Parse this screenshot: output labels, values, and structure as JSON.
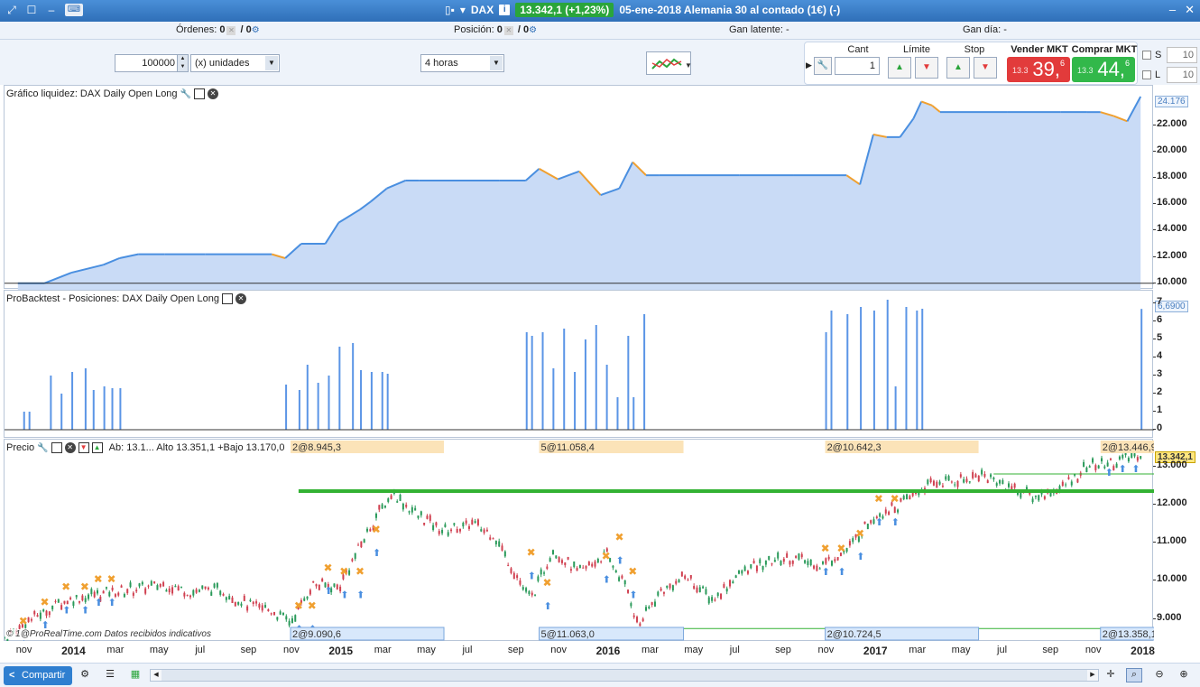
{
  "window": {
    "symbol": "DAX",
    "price_change": "13.342,1 (+1,23%)",
    "description": "05-ene-2018 Alemania 30 al contado (1€) (-)"
  },
  "infobar": {
    "ordenes_label": "Órdenes:",
    "ordenes_val": "0",
    "ordenes_val2": "/ 0",
    "posicion_label": "Posición:",
    "posicion_val": "0",
    "posicion_val2": "/ 0",
    "gan_latente": "Gan latente: -",
    "gan_dia": "Gan día: -"
  },
  "controls": {
    "quantity": "100000",
    "unit": "(x) unidades",
    "timeframe": "4 horas"
  },
  "order": {
    "cant_label": "Cant",
    "cant_value": "1",
    "limite_label": "Límite",
    "stop_label": "Stop",
    "vender_label": "Vender MKT",
    "vender_prefix": "13.3",
    "vender_main": "39,",
    "vender_sup": "6",
    "comprar_label": "Comprar MKT",
    "comprar_prefix": "13.3",
    "comprar_main": "44,",
    "comprar_sup": "6",
    "s_label": "S",
    "s_value": "10",
    "l_label": "L",
    "l_value": "10"
  },
  "panels": {
    "equity": {
      "title": "Gráfico liquidez: DAX Daily Open Long",
      "current": "24.176",
      "ticks": [
        "22.000",
        "20.000",
        "18.000",
        "16.000",
        "14.000",
        "12.000",
        "10.000"
      ]
    },
    "positions": {
      "title": "ProBacktest - Posiciones: DAX Daily Open Long",
      "current": "6,6900",
      "ticks": [
        "7",
        "6",
        "5",
        "4",
        "3",
        "2",
        "1",
        "0"
      ]
    },
    "price": {
      "title": "Precio",
      "ohlc": "Ab: 13.1... Alto 13.351,1 +Bajo 13.170,0",
      "current": "13.342,1",
      "ticks": [
        "13.000",
        "12.000",
        "11.000",
        "10.000",
        "9.000"
      ],
      "top_labels": [
        "2@8.945,3",
        "5@11.058,4",
        "2@10.642,3",
        "2@13.446,9"
      ],
      "bottom_labels": [
        "2@9.090,6",
        "5@11.063,0",
        "2@10.724,5",
        "2@13.358,1"
      ],
      "copyright": "© 1@ProRealTime.com Datos recibidos indicativos"
    }
  },
  "xaxis": {
    "labels": [
      "nov",
      "2014",
      "mar",
      "may",
      "jul",
      "sep",
      "nov",
      "2015",
      "mar",
      "may",
      "jul",
      "sep",
      "nov",
      "2016",
      "mar",
      "may",
      "jul",
      "sep",
      "nov",
      "2017",
      "mar",
      "may",
      "jul",
      "sep",
      "nov",
      "2018"
    ]
  },
  "bottombar": {
    "share_label": "Compartir"
  },
  "colors": {
    "title_blue": "#2f6fb8",
    "price_green": "#2aa53b",
    "sell_red": "#e23b3b",
    "buy_green": "#32b84a",
    "equity_fill": "#c9dbf6",
    "equity_line_up": "#4a8fe0",
    "equity_line_down": "#f0a030",
    "bar_blue": "#5b95e6",
    "support_green": "#33b233",
    "resistance_red": "#dd2222"
  },
  "chart_data": [
    {
      "type": "area",
      "title": "Gráfico liquidez: DAX Daily Open Long",
      "x": [
        2013.8,
        2013.9,
        2014.0,
        2014.12,
        2014.18,
        2014.25,
        2014.35,
        2014.5,
        2014.75,
        2014.8,
        2014.86,
        2014.95,
        2015.0,
        2015.08,
        2015.12,
        2015.18,
        2015.25,
        2015.3,
        2015.6,
        2015.7,
        2015.75,
        2015.82,
        2015.9,
        2015.98,
        2016.05,
        2016.1,
        2016.15,
        2016.2,
        2016.3,
        2016.5,
        2016.7,
        2016.9,
        2016.95,
        2017.0,
        2017.05,
        2017.1,
        2017.15,
        2017.18,
        2017.22,
        2017.25,
        2017.5,
        2017.7,
        2017.8,
        2017.85,
        2017.9,
        2017.95,
        2018.0
      ],
      "values": [
        10000,
        10000,
        10800,
        11400,
        11900,
        12200,
        12200,
        12200,
        12200,
        11900,
        13000,
        13000,
        14600,
        15600,
        16200,
        17200,
        17800,
        17800,
        17800,
        17800,
        18700,
        17900,
        18500,
        16700,
        17200,
        19200,
        18200,
        18200,
        18200,
        18200,
        18200,
        18200,
        17500,
        21300,
        21100,
        21100,
        22500,
        23800,
        23500,
        23000,
        23000,
        23000,
        23000,
        23000,
        22700,
        22300,
        24176
      ],
      "ylim": [
        9500,
        25000
      ]
    },
    {
      "type": "bar",
      "title": "ProBacktest - Posiciones: DAX Daily Open Long",
      "x": [
        2013.82,
        2013.84,
        2013.92,
        2013.96,
        2014.0,
        2014.05,
        2014.08,
        2014.12,
        2014.15,
        2014.18,
        2014.8,
        2014.85,
        2014.88,
        2014.92,
        2014.96,
        2015.0,
        2015.05,
        2015.08,
        2015.12,
        2015.16,
        2015.18,
        2015.7,
        2015.72,
        2015.76,
        2015.8,
        2015.84,
        2015.88,
        2015.92,
        2015.96,
        2016.0,
        2016.04,
        2016.08,
        2016.1,
        2016.14,
        2016.82,
        2016.84,
        2016.9,
        2016.95,
        2017.0,
        2017.05,
        2017.08,
        2017.12,
        2017.16,
        2017.18,
        2017.88,
        2017.9,
        2017.94,
        2017.97,
        2018.0
      ],
      "values": [
        1,
        1,
        3,
        2,
        3.2,
        3.4,
        2.2,
        2.4,
        2.3,
        2.3,
        2.5,
        2.2,
        3.6,
        2.6,
        3,
        4.6,
        4.8,
        3.3,
        3.2,
        3.2,
        3.1,
        5.4,
        5.2,
        5.4,
        3.4,
        5.6,
        3.2,
        5.0,
        5.8,
        3.6,
        1.8,
        5.2,
        1.8,
        6.4,
        5.4,
        6.6,
        6.4,
        6.8,
        6.6,
        7.2,
        2.4,
        6.8,
        6.6,
        6.7,
        0,
        0,
        0,
        0,
        6.69
      ],
      "ylim": [
        0,
        7.5
      ]
    },
    {
      "type": "line",
      "title": "Precio",
      "x": [
        2013.75,
        2013.85,
        2013.95,
        2014.05,
        2014.15,
        2014.25,
        2014.35,
        2014.45,
        2014.55,
        2014.65,
        2014.75,
        2014.82,
        2014.9,
        2015.0,
        2015.08,
        2015.15,
        2015.2,
        2015.25,
        2015.3,
        2015.4,
        2015.5,
        2015.58,
        2015.65,
        2015.72,
        2015.8,
        2015.9,
        2016.0,
        2016.08,
        2016.12,
        2016.2,
        2016.3,
        2016.4,
        2016.5,
        2016.6,
        2016.7,
        2016.8,
        2016.9,
        2017.0,
        2017.1,
        2017.2,
        2017.3,
        2017.4,
        2017.5,
        2017.6,
        2017.7,
        2017.8,
        2017.9,
        2018.0
      ],
      "values": [
        8500,
        9000,
        9400,
        9600,
        9700,
        9800,
        9900,
        9700,
        9800,
        9400,
        9200,
        8900,
        9900,
        9800,
        10900,
        11800,
        12300,
        12000,
        11700,
        11300,
        11500,
        11200,
        10300,
        9500,
        10800,
        10200,
        10700,
        9800,
        8800,
        9700,
        10100,
        9500,
        10200,
        10500,
        10600,
        10400,
        10800,
        11700,
        12000,
        12500,
        12600,
        12800,
        12500,
        12200,
        12400,
        13000,
        13100,
        13342
      ],
      "ylim": [
        8400,
        13700
      ],
      "annotations": {
        "support": 12350,
        "resistance": 13600,
        "low_line": 8750
      }
    }
  ]
}
